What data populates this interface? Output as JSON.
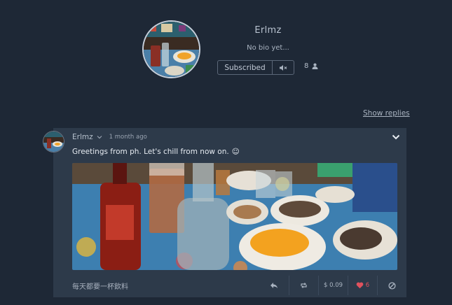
{
  "profile": {
    "name": "Erlmz",
    "bio": "No bio yet...",
    "subscribe_label": "Subscribed",
    "subscriber_count": "8"
  },
  "thread": {
    "show_replies_label": "Show replies"
  },
  "post": {
    "author": "Erlmz",
    "time": "1 month ago",
    "text": "Greetings from ph. Let's chill from now on.",
    "emoji": "☺",
    "footer_text": "每天都要一杯飲料",
    "tip_amount": "$ 0.09",
    "like_count": "6"
  },
  "colors": {
    "background": "#1e2836",
    "card": "#2d3a4a",
    "like": "#e0525e"
  },
  "icons": [
    "chevron-down-icon",
    "speaker-mute-icon",
    "user-icon",
    "reply-icon",
    "repost-icon",
    "heart-icon",
    "block-icon"
  ]
}
